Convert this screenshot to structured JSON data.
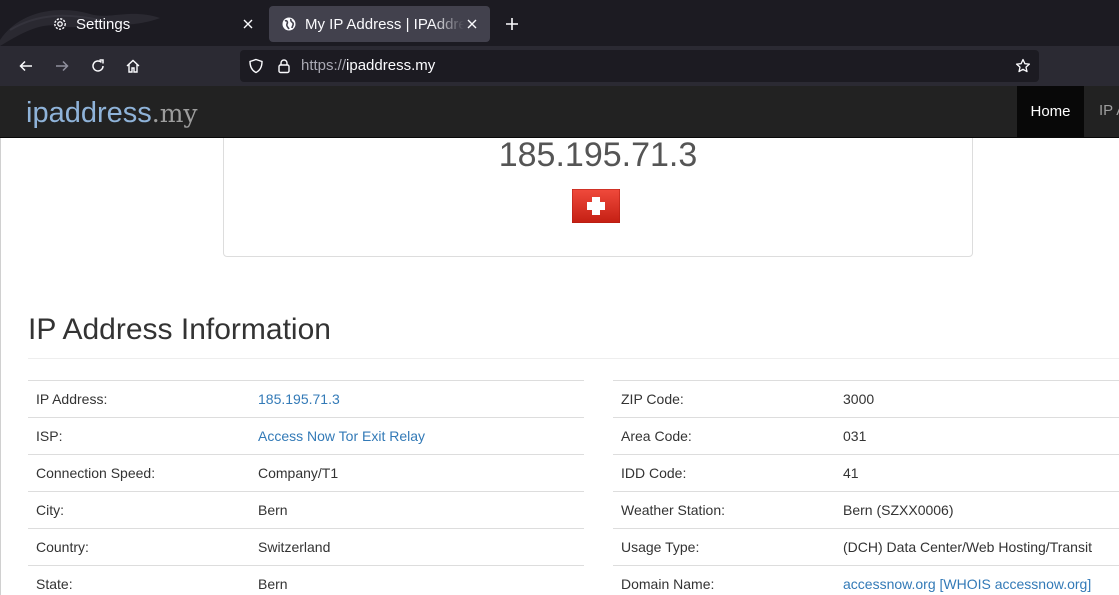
{
  "browser": {
    "tabs": [
      {
        "label": "Settings",
        "icon": "gear-icon",
        "active": false
      },
      {
        "label": "My IP Address | IPAddress.my",
        "icon": "globe-icon",
        "active": true
      }
    ],
    "url": {
      "scheme": "https://",
      "host": "ipaddress.my"
    }
  },
  "site": {
    "brand_main": "ipaddress",
    "brand_tld": ".my",
    "menu": [
      "Home",
      "IP A"
    ]
  },
  "hero": {
    "ip": "185.195.71.3",
    "flag": "switzerland-flag"
  },
  "section": {
    "title": "IP Address Information"
  },
  "left_rows": [
    {
      "label": "IP Address:",
      "value": "185.195.71.3",
      "link": true
    },
    {
      "label": "ISP:",
      "value": "Access Now Tor Exit Relay",
      "link": true
    },
    {
      "label": "Connection Speed:",
      "value": "Company/T1",
      "link": false
    },
    {
      "label": "City:",
      "value": "Bern",
      "link": false
    },
    {
      "label": "Country:",
      "value": "Switzerland",
      "link": false
    },
    {
      "label": "State:",
      "value": "Bern",
      "link": false
    }
  ],
  "right_rows": [
    {
      "label": "ZIP Code:",
      "value": "3000",
      "link": false
    },
    {
      "label": "Area Code:",
      "value": "031",
      "link": false
    },
    {
      "label": "IDD Code:",
      "value": "41",
      "link": false
    },
    {
      "label": "Weather Station:",
      "value": "Bern (SZXX0006)",
      "link": false
    },
    {
      "label": "Usage Type:",
      "value": "(DCH) Data Center/Web Hosting/Transit",
      "link": false
    },
    {
      "label": "Domain Name:",
      "value": "accessnow.org [WHOIS accessnow.org]",
      "link": true
    }
  ],
  "colors": {
    "link": "#337ab7",
    "nav_bg": "#222222",
    "flag_red": "#d52b1e"
  }
}
